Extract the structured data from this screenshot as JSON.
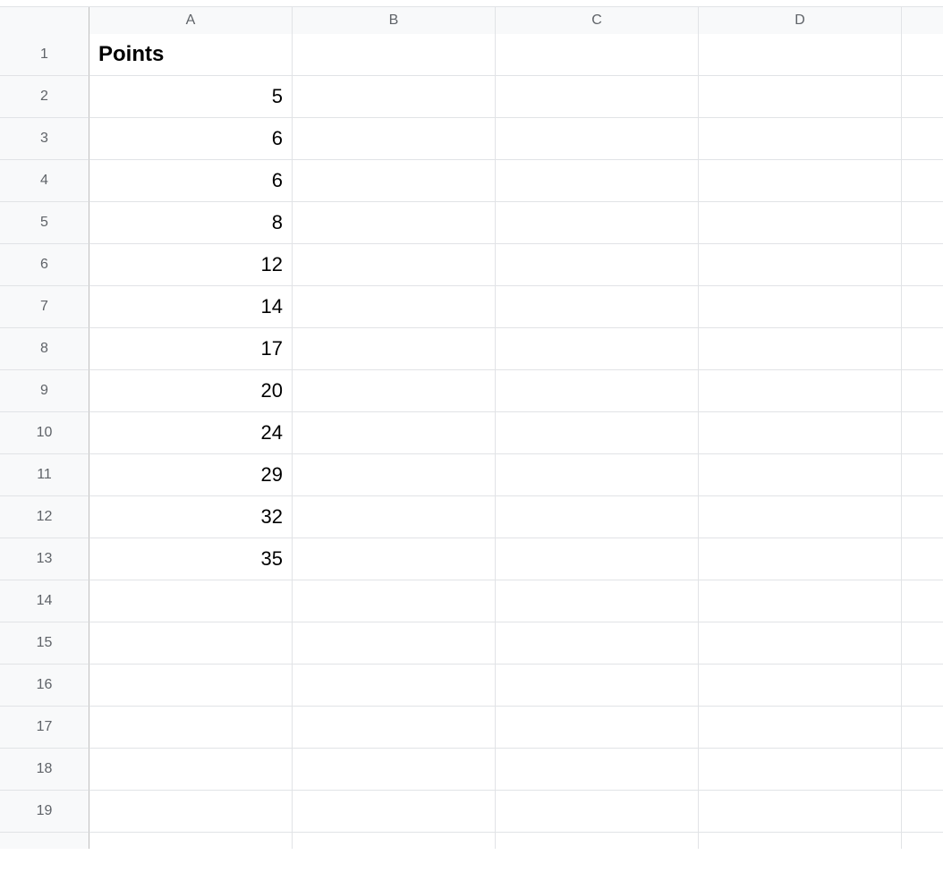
{
  "columns": [
    "A",
    "B",
    "C",
    "D"
  ],
  "rowCount": 19,
  "data": {
    "A1": {
      "value": "Points",
      "bold": true,
      "align": "left"
    },
    "A2": {
      "value": "5",
      "align": "right"
    },
    "A3": {
      "value": "6",
      "align": "right"
    },
    "A4": {
      "value": "6",
      "align": "right"
    },
    "A5": {
      "value": "8",
      "align": "right"
    },
    "A6": {
      "value": "12",
      "align": "right"
    },
    "A7": {
      "value": "14",
      "align": "right"
    },
    "A8": {
      "value": "17",
      "align": "right"
    },
    "A9": {
      "value": "20",
      "align": "right"
    },
    "A10": {
      "value": "24",
      "align": "right"
    },
    "A11": {
      "value": "29",
      "align": "right"
    },
    "A12": {
      "value": "32",
      "align": "right"
    },
    "A13": {
      "value": "35",
      "align": "right"
    }
  }
}
